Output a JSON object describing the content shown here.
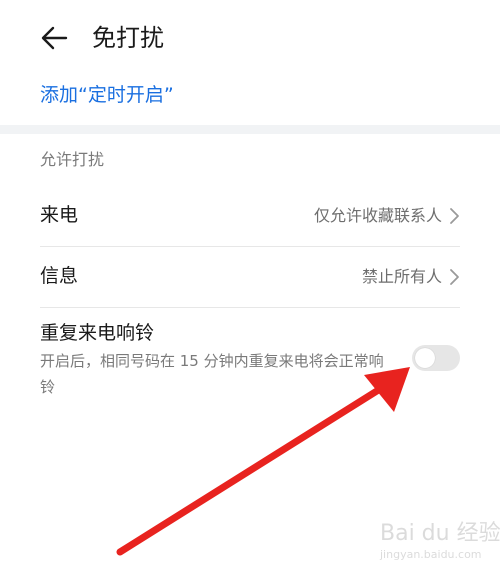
{
  "header": {
    "title": "免打扰",
    "back_icon": "arrow-left-icon"
  },
  "add_timer_label": "添加“定时开启”",
  "section_label": "允许打扰",
  "rows": [
    {
      "label": "来电",
      "value": "仅允许收藏联系人",
      "icon": "chevron-right-icon"
    },
    {
      "label": "信息",
      "value": "禁止所有人",
      "icon": "chevron-right-icon"
    }
  ],
  "repeat_call": {
    "title": "重复来电响铃",
    "description": "开启后，相同号码在 15 分钟内重复来电将会正常响铃",
    "enabled": false
  },
  "watermark": {
    "logo": "Bai du 经验",
    "sub": "jingyan.baidu.com"
  },
  "colors": {
    "accent": "#1a6fe0",
    "annotation_arrow": "#e8231f",
    "toggle_off": "#e6e6e6"
  }
}
